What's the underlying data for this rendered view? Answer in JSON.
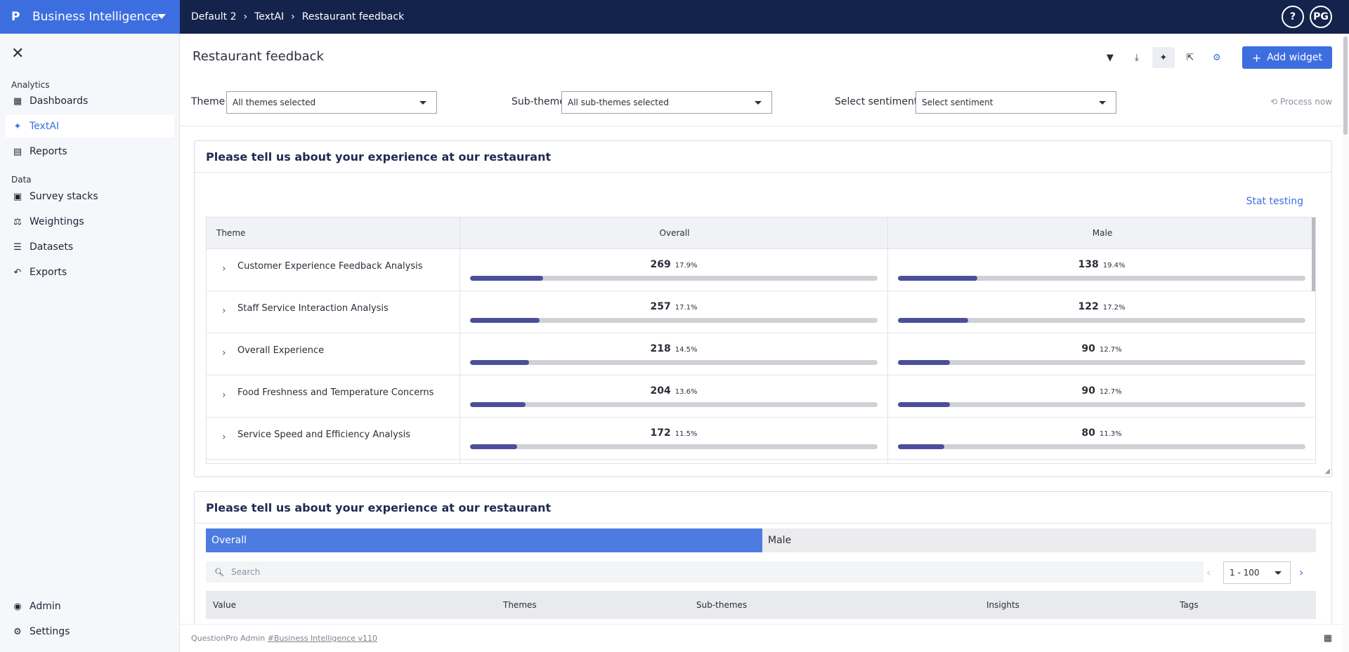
{
  "brand": {
    "name": "Business Intelligence",
    "logo": "P"
  },
  "breadcrumb": [
    "Default 2",
    "TextAI",
    "Restaurant feedback"
  ],
  "topbar": {
    "help": "?",
    "avatar": "PG"
  },
  "sidebar": {
    "analytics_label": "Analytics",
    "data_label": "Data",
    "items": {
      "dashboards": "Dashboards",
      "textai": "TextAI",
      "reports": "Reports",
      "survey_stacks": "Survey stacks",
      "weightings": "Weightings",
      "datasets": "Datasets",
      "exports": "Exports",
      "admin": "Admin",
      "settings": "Settings"
    }
  },
  "page": {
    "title": "Restaurant feedback",
    "add_widget": "Add widget",
    "process_now": "Process now"
  },
  "filters": {
    "theme_label": "Theme",
    "theme_value": "All themes selected",
    "subtheme_label": "Sub-theme",
    "subtheme_value": "All sub-themes selected",
    "sentiment_label": "Select sentiment",
    "sentiment_placeholder": "Select sentiment"
  },
  "widget1": {
    "title": "Please tell us about your experience at our restaurant",
    "stat_testing": "Stat testing",
    "columns": [
      "Theme",
      "Overall",
      "Male"
    ],
    "rows": [
      {
        "theme": "Customer Experience Feedback Analysis",
        "overall": {
          "count": "269",
          "pct": "17.9%",
          "frac": 0.179
        },
        "male": {
          "count": "138",
          "pct": "19.4%",
          "frac": 0.194
        }
      },
      {
        "theme": "Staff Service Interaction Analysis",
        "overall": {
          "count": "257",
          "pct": "17.1%",
          "frac": 0.171
        },
        "male": {
          "count": "122",
          "pct": "17.2%",
          "frac": 0.172
        }
      },
      {
        "theme": "Overall Experience",
        "overall": {
          "count": "218",
          "pct": "14.5%",
          "frac": 0.145
        },
        "male": {
          "count": "90",
          "pct": "12.7%",
          "frac": 0.127
        }
      },
      {
        "theme": "Food Freshness and Temperature Concerns",
        "overall": {
          "count": "204",
          "pct": "13.6%",
          "frac": 0.136
        },
        "male": {
          "count": "90",
          "pct": "12.7%",
          "frac": 0.127
        }
      },
      {
        "theme": "Service Speed and Efficiency Analysis",
        "overall": {
          "count": "172",
          "pct": "11.5%",
          "frac": 0.115
        },
        "male": {
          "count": "80",
          "pct": "11.3%",
          "frac": 0.113
        }
      }
    ]
  },
  "widget2": {
    "title": "Please tell us about your experience at our restaurant",
    "tabs": [
      "Overall",
      "Male"
    ],
    "search_placeholder": "Search",
    "pager_range": "1 - 100",
    "columns": [
      "Value",
      "Themes",
      "Sub-themes",
      "Insights",
      "Tags"
    ]
  },
  "footer": {
    "prefix": "QuestionPro Admin",
    "link": "#Business Intelligence v110"
  },
  "colors": {
    "brand": "#3d6ee0",
    "topbar": "#14234b",
    "bar_fill": "#4b4f9a"
  }
}
